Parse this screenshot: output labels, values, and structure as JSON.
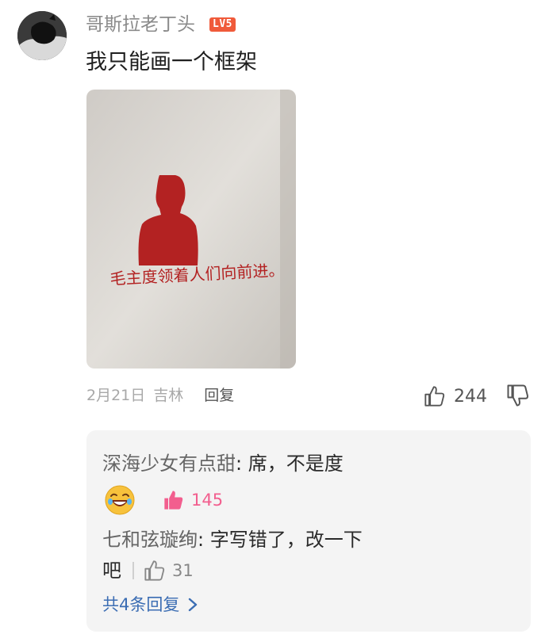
{
  "comment": {
    "username": "哥斯拉老丁头",
    "level_badge": "LV5",
    "text": "我只能画一个框架",
    "photo": {
      "caption_text": "毛主度领着人们向前进。",
      "colors": {
        "wall": "#dcd9d4",
        "silhouette": "#b32222"
      }
    },
    "date": "2月21日",
    "location": "吉林",
    "reply_label": "回复",
    "like_count": "244"
  },
  "replies": {
    "items": [
      {
        "author": "深海少女有点甜",
        "text": ": 席，不是度",
        "like_count": "145",
        "liked": true
      },
      {
        "author": "七和弦璇绚",
        "text": ": 字写错了，改一下",
        "text_wrap": "吧",
        "like_count": "31",
        "liked": false
      }
    ],
    "more_label": "共4条回复"
  },
  "colors": {
    "accent_link": "#3b6db3",
    "liked_pink": "#f25e8e",
    "badge": "#f05a3a"
  },
  "icons": [
    "thumb-up-icon",
    "thumb-down-icon",
    "laughing-emoji-icon",
    "chevron-right-icon"
  ]
}
